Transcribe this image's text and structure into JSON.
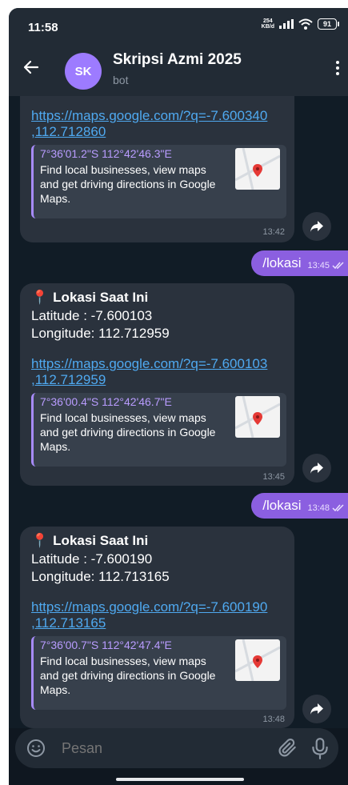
{
  "status": {
    "time": "11:58",
    "speed_top": "254",
    "speed_bottom": "KB/d",
    "battery": "91"
  },
  "header": {
    "avatar": "SK",
    "name": "Skripsi Azmi 2025",
    "subtitle": "bot"
  },
  "messages": [
    {
      "link": "https://maps.google.com/?q=-7.600340,112.712860",
      "link_lines": [
        "https://maps.google.com/?q=-7.600340",
        ",112.712860"
      ],
      "preview_title": "7°36'01.2\"S 112°42'46.3\"E",
      "preview_desc": "Find local businesses, view maps and get driving directions in Google Maps.",
      "time": "13:42"
    },
    {
      "out_text": "/lokasi",
      "out_time": "13:45"
    },
    {
      "title": "Lokasi Saat Ini",
      "lat": "Latitude : -7.600103",
      "lng": "Longitude: 112.712959",
      "link_lines": [
        "https://maps.google.com/?q=-7.600103",
        ",112.712959"
      ],
      "preview_title": "7°36'00.4\"S 112°42'46.7\"E",
      "preview_desc": "Find local businesses, view maps and get driving directions in Google Maps.",
      "time": "13:45"
    },
    {
      "out_text": "/lokasi",
      "out_time": "13:48"
    },
    {
      "title": "Lokasi Saat Ini",
      "lat": "Latitude : -7.600190",
      "lng": "Longitude: 112.713165",
      "link_lines": [
        "https://maps.google.com/?q=-7.600190",
        ",112.713165"
      ],
      "preview_title": "7°36'00.7\"S 112°42'47.4\"E",
      "preview_desc": "Find local businesses, view maps and get driving directions in Google Maps.",
      "time": "13:48"
    }
  ],
  "input": {
    "placeholder": "Pesan"
  },
  "colors": {
    "bubble_out": "#8b5fe0",
    "link": "#4fa9f0",
    "preview_title": "#b99cff",
    "background": "#111c26"
  },
  "icons": [
    "back-arrow-icon",
    "more-vert-icon",
    "share-icon",
    "emoji-icon",
    "attach-icon",
    "mic-icon",
    "double-check-icon",
    "pin-icon",
    "signal-icon",
    "wifi-icon",
    "battery-icon"
  ]
}
